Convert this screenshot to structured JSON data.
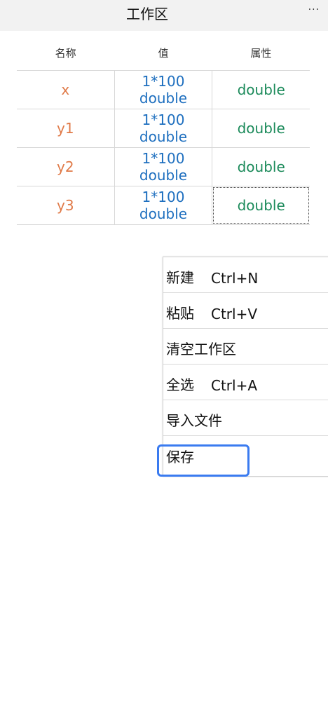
{
  "header": {
    "title": "工作区",
    "more_label": "···"
  },
  "table": {
    "columns": [
      "名称",
      "值",
      "属性"
    ],
    "rows": [
      {
        "name": "x",
        "value_line1": "1*100",
        "value_line2": "double",
        "attribute": "double"
      },
      {
        "name": "y1",
        "value_line1": "1*100",
        "value_line2": "double",
        "attribute": "double"
      },
      {
        "name": "y2",
        "value_line1": "1*100",
        "value_line2": "double",
        "attribute": "double"
      },
      {
        "name": "y3",
        "value_line1": "1*100",
        "value_line2": "double",
        "attribute": "double"
      }
    ]
  },
  "context_menu": {
    "items": [
      {
        "label": "新建",
        "shortcut": "Ctrl+N"
      },
      {
        "label": "粘贴",
        "shortcut": "Ctrl+V"
      },
      {
        "label": "清空工作区",
        "shortcut": ""
      },
      {
        "label": "全选",
        "shortcut": "Ctrl+A"
      },
      {
        "label": "导入文件",
        "shortcut": ""
      },
      {
        "label": "保存",
        "shortcut": ""
      }
    ]
  },
  "colors": {
    "name": "#e07a48",
    "value": "#1e6fbf",
    "attribute": "#1b8a5a",
    "focus": "#3a7bf0"
  }
}
